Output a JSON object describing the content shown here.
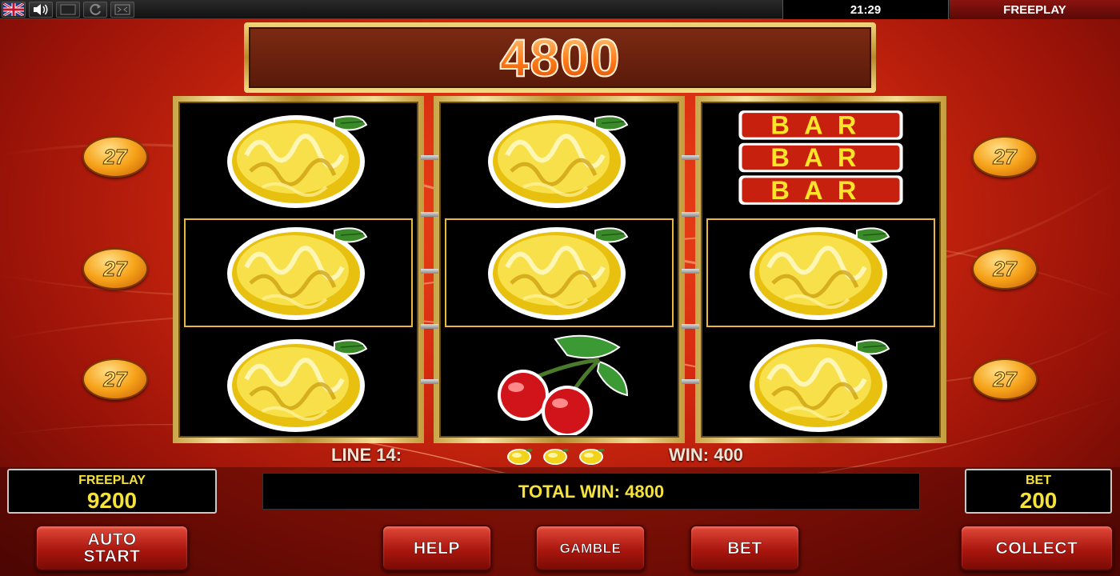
{
  "topbar": {
    "clock": "21:29",
    "mode_label": "FREEPLAY",
    "icons": [
      "uk-flag-icon",
      "speaker-icon",
      "window-icon",
      "refresh-icon",
      "fullscreen-icon"
    ]
  },
  "win_display": {
    "amount": "4800"
  },
  "reels": [
    [
      "lemon",
      "lemon",
      "lemon"
    ],
    [
      "lemon",
      "lemon",
      "cherries"
    ],
    [
      "bar-triple",
      "lemon",
      "lemon"
    ]
  ],
  "highlighted_row": 1,
  "bar_symbol": {
    "text": "BAR"
  },
  "line_badges": {
    "left": [
      "27",
      "27",
      "27"
    ],
    "right": [
      "27",
      "27",
      "27"
    ]
  },
  "line_info": {
    "line_label": "LINE 14:",
    "symbol_count": 3,
    "symbol": "lemon",
    "win_label": "WIN: 400"
  },
  "counters": {
    "credit_label": "FREEPLAY",
    "credit_value": "9200",
    "bet_label": "BET",
    "bet_value": "200"
  },
  "total_win": "TOTAL WIN: 4800",
  "buttons": {
    "auto_start_line1": "AUTO",
    "auto_start_line2": "START",
    "help": "HELP",
    "gamble": "GAMBLE",
    "bet": "BET",
    "collect": "COLLECT"
  },
  "colors": {
    "accent_yellow": "#f5e23a",
    "button_red": "#a9160e",
    "gold": "#e9b73a"
  }
}
